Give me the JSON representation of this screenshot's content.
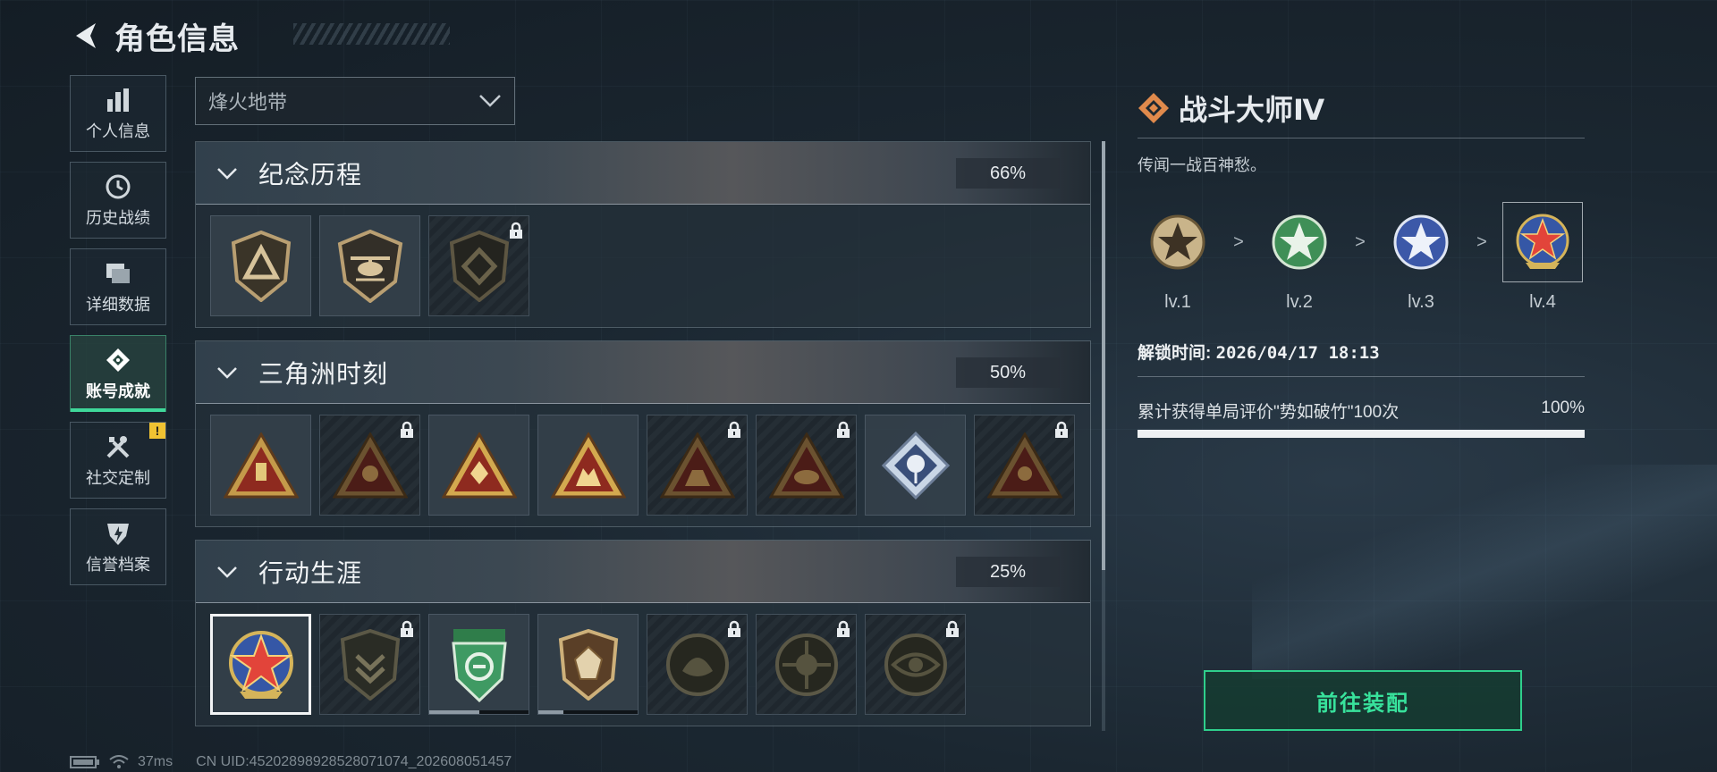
{
  "header": {
    "title": "角色信息"
  },
  "sidebar": {
    "items": [
      {
        "label": "个人信息",
        "icon": "bar-chart-icon"
      },
      {
        "label": "历史战绩",
        "icon": "clock-icon"
      },
      {
        "label": "详细数据",
        "icon": "folder-icon"
      },
      {
        "label": "账号成就",
        "icon": "achievement-icon",
        "active": true
      },
      {
        "label": "社交定制",
        "icon": "tools-icon",
        "badge": "!"
      },
      {
        "label": "信誉档案",
        "icon": "shield-bolt-icon"
      }
    ]
  },
  "mode_select": {
    "value": "烽火地带"
  },
  "categories": [
    {
      "name": "纪念历程",
      "percent": "66%",
      "medals": [
        {
          "icon": "triangle-shield-icon",
          "locked": false
        },
        {
          "icon": "helicopter-shield-icon",
          "locked": false
        },
        {
          "icon": "diamond-shield-icon",
          "locked": true
        }
      ]
    },
    {
      "name": "三角洲时刻",
      "percent": "50%",
      "medals": [
        {
          "icon": "triangle-medal-icon",
          "locked": false
        },
        {
          "icon": "triangle-medal-icon",
          "locked": true
        },
        {
          "icon": "triangle-medal-icon",
          "locked": false
        },
        {
          "icon": "triangle-medal-icon",
          "locked": false
        },
        {
          "icon": "triangle-medal-icon",
          "locked": true
        },
        {
          "icon": "triangle-medal-icon",
          "locked": true
        },
        {
          "icon": "rose-diamond-icon",
          "locked": false
        },
        {
          "icon": "triangle-medal-icon",
          "locked": true
        }
      ]
    },
    {
      "name": "行动生涯",
      "percent": "25%",
      "medals": [
        {
          "icon": "star-badge-icon",
          "locked": false,
          "selected": true
        },
        {
          "icon": "chevron-shield-icon",
          "locked": true
        },
        {
          "icon": "green-shield-icon",
          "locked": false,
          "progress": 0.5
        },
        {
          "icon": "gem-shield-icon",
          "locked": false,
          "progress": 0.25
        },
        {
          "icon": "round-emblem-icon",
          "locked": true
        },
        {
          "icon": "crosshair-emblem-icon",
          "locked": true
        },
        {
          "icon": "eye-emblem-icon",
          "locked": true
        }
      ]
    }
  ],
  "detail": {
    "title": "战斗大师Ⅳ",
    "description": "传闻一战百神愁。",
    "levels": [
      {
        "label": "lv.1",
        "color": "#b9a27a"
      },
      {
        "label": "lv.2",
        "color": "#3f8f57"
      },
      {
        "label": "lv.3",
        "color": "#8aa0d8"
      },
      {
        "label": "lv.4",
        "color": "#d94b3a"
      }
    ],
    "level_arrow": ">",
    "unlock_label": "解锁时间:",
    "unlock_time": "2026/04/17 18:13",
    "requirement": "累计获得单局评价\"势如破竹\"100次",
    "requirement_percent": "100%",
    "progress": 1.0
  },
  "equip_button": {
    "label": "前往装配"
  },
  "footer": {
    "ping": "37ms",
    "uid": "CN UID:452028989285280710​74_202608051457"
  },
  "colors": {
    "accent": "#38e29c",
    "warn": "#f0c232"
  }
}
